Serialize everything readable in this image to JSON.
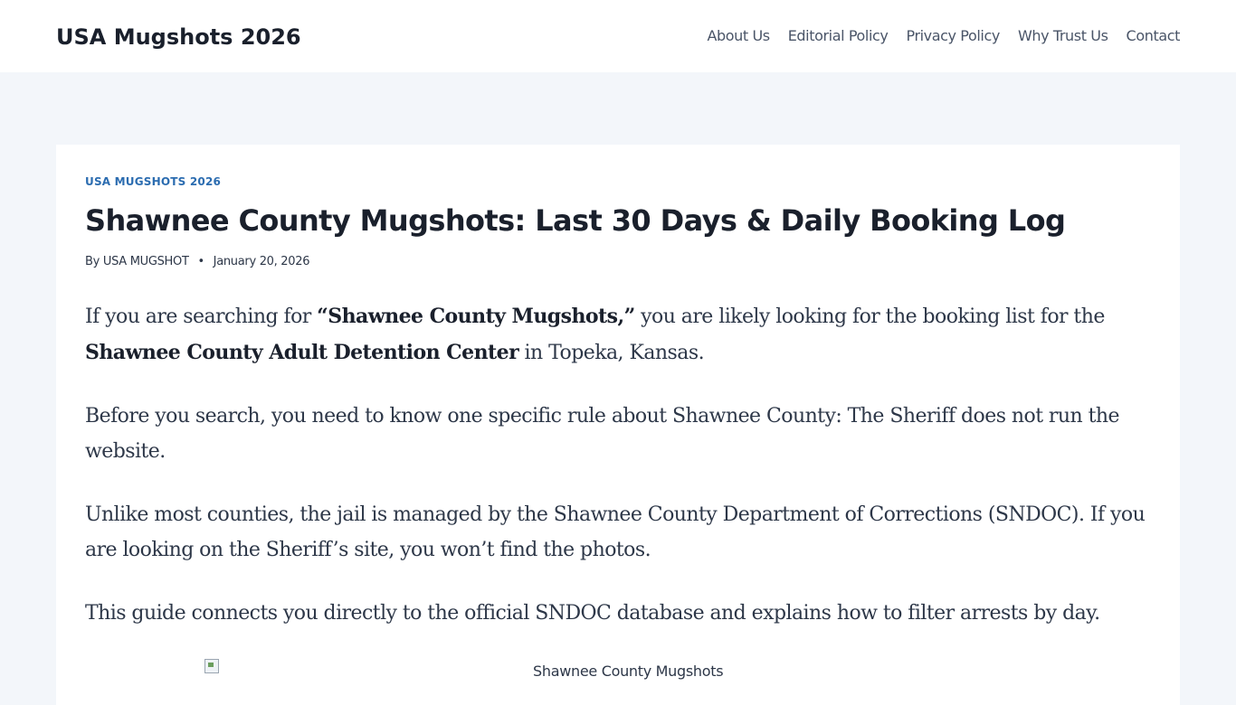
{
  "header": {
    "site_title": "USA Mugshots 2026",
    "nav": [
      {
        "label": "About Us"
      },
      {
        "label": "Editorial Policy"
      },
      {
        "label": "Privacy Policy"
      },
      {
        "label": "Why Trust Us"
      },
      {
        "label": "Contact"
      }
    ]
  },
  "article": {
    "category": "USA MUGSHOTS 2026",
    "title": "Shawnee County Mugshots: Last 30 Days & Daily Booking Log",
    "meta": {
      "by_prefix": "By",
      "author": "USA MUGSHOT",
      "separator": "•",
      "date": "January 20, 2026"
    },
    "paragraphs": [
      {
        "p1_a": "If you are searching for ",
        "p1_strong_a": "“Shawnee County Mugshots,”",
        "p1_b": " you are likely looking for the booking list for the ",
        "p1_strong_b": "Shawnee County Adult Detention Center",
        "p1_c": " in Topeka, Kansas."
      },
      {
        "text": "Before you search, you need to know one specific rule about Shawnee County: The Sheriff does not run the website."
      },
      {
        "text": "Unlike most counties, the jail is managed by the Shawnee County Department of Corrections (SNDOC). If you are looking on the Sheriff’s site, you won’t find the photos."
      },
      {
        "text": "This guide connects you directly to the official SNDOC database and explains how to filter arrests by day."
      }
    ],
    "image_alt": "Shawnee County Mugshots"
  },
  "colors": {
    "page_background": "#f3f6fa",
    "header_background": "#ffffff",
    "accent_link": "#2b6cb0",
    "text_dark": "#1a202c",
    "text_body": "#2d3748"
  }
}
